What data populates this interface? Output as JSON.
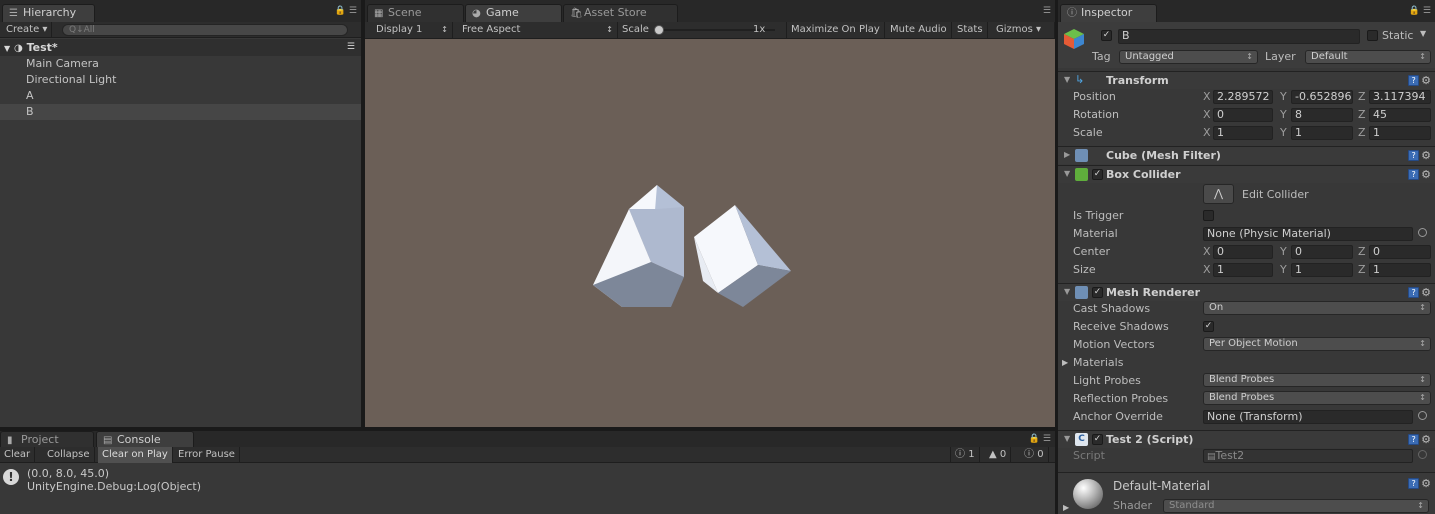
{
  "hierarchy": {
    "tab": "Hierarchy",
    "create_label": "Create",
    "search_placeholder": "Q↓All",
    "scene_name": "Test*",
    "items": [
      "Main Camera",
      "Directional Light",
      "A",
      "B"
    ],
    "selected_index": 3
  },
  "center_tabs": [
    {
      "label": "Scene",
      "icon": "grid-icon"
    },
    {
      "label": "Game",
      "icon": "pacman-icon"
    },
    {
      "label": "Asset Store",
      "icon": "bag-icon"
    }
  ],
  "game_toolbar": {
    "display": "Display 1",
    "aspect": "Free Aspect",
    "scale_label": "Scale",
    "scale_value": "1x",
    "maximize": "Maximize On Play",
    "mute": "Mute Audio",
    "stats": "Stats",
    "gizmos": "Gizmos"
  },
  "bottom": {
    "tabs": [
      "Project",
      "Console"
    ],
    "buttons": [
      "Clear",
      "Collapse",
      "Clear on Play",
      "Error Pause"
    ],
    "counts": {
      "info": "1",
      "warning": "0",
      "error": "0"
    },
    "log_line1": "(0.0, 8.0, 45.0)",
    "log_line2": "UnityEngine.Debug:Log(Object)"
  },
  "inspector": {
    "tab": "Inspector",
    "object_name": "B",
    "static_label": "Static",
    "tag_label": "Tag",
    "tag_value": "Untagged",
    "layer_label": "Layer",
    "layer_value": "Default",
    "transform": {
      "title": "Transform",
      "position_label": "Position",
      "rotation_label": "Rotation",
      "scale_label": "Scale",
      "position": [
        "2.289572",
        "-0.652896",
        "3.117394"
      ],
      "rotation": [
        "0",
        "8",
        "45"
      ],
      "scale": [
        "1",
        "1",
        "1"
      ]
    },
    "mesh_filter": {
      "title": "Cube (Mesh Filter)"
    },
    "box_collider": {
      "title": "Box Collider",
      "edit_label": "Edit Collider",
      "is_trigger_label": "Is Trigger",
      "material_label": "Material",
      "material_value": "None (Physic Material)",
      "center_label": "Center",
      "center": [
        "0",
        "0",
        "0"
      ],
      "size_label": "Size",
      "size": [
        "1",
        "1",
        "1"
      ]
    },
    "mesh_renderer": {
      "title": "Mesh Renderer",
      "cast_label": "Cast Shadows",
      "cast_value": "On",
      "receive_label": "Receive Shadows",
      "motion_label": "Motion Vectors",
      "motion_value": "Per Object Motion",
      "materials_label": "Materials",
      "light_label": "Light Probes",
      "light_value": "Blend Probes",
      "reflection_label": "Reflection Probes",
      "reflection_value": "Blend Probes",
      "anchor_label": "Anchor Override",
      "anchor_value": "None (Transform)"
    },
    "script": {
      "title": "Test 2 (Script)",
      "label": "Script",
      "value": "Test2"
    },
    "material": {
      "name": "Default-Material",
      "shader_label": "Shader",
      "shader_value": "Standard"
    }
  },
  "colors": {
    "panel": "#383838",
    "game_bg": "#6b5f57",
    "cube_top": "#b4c0d6",
    "cube_left": "#f6f8fc",
    "cube_bottom": "#7d8799"
  }
}
